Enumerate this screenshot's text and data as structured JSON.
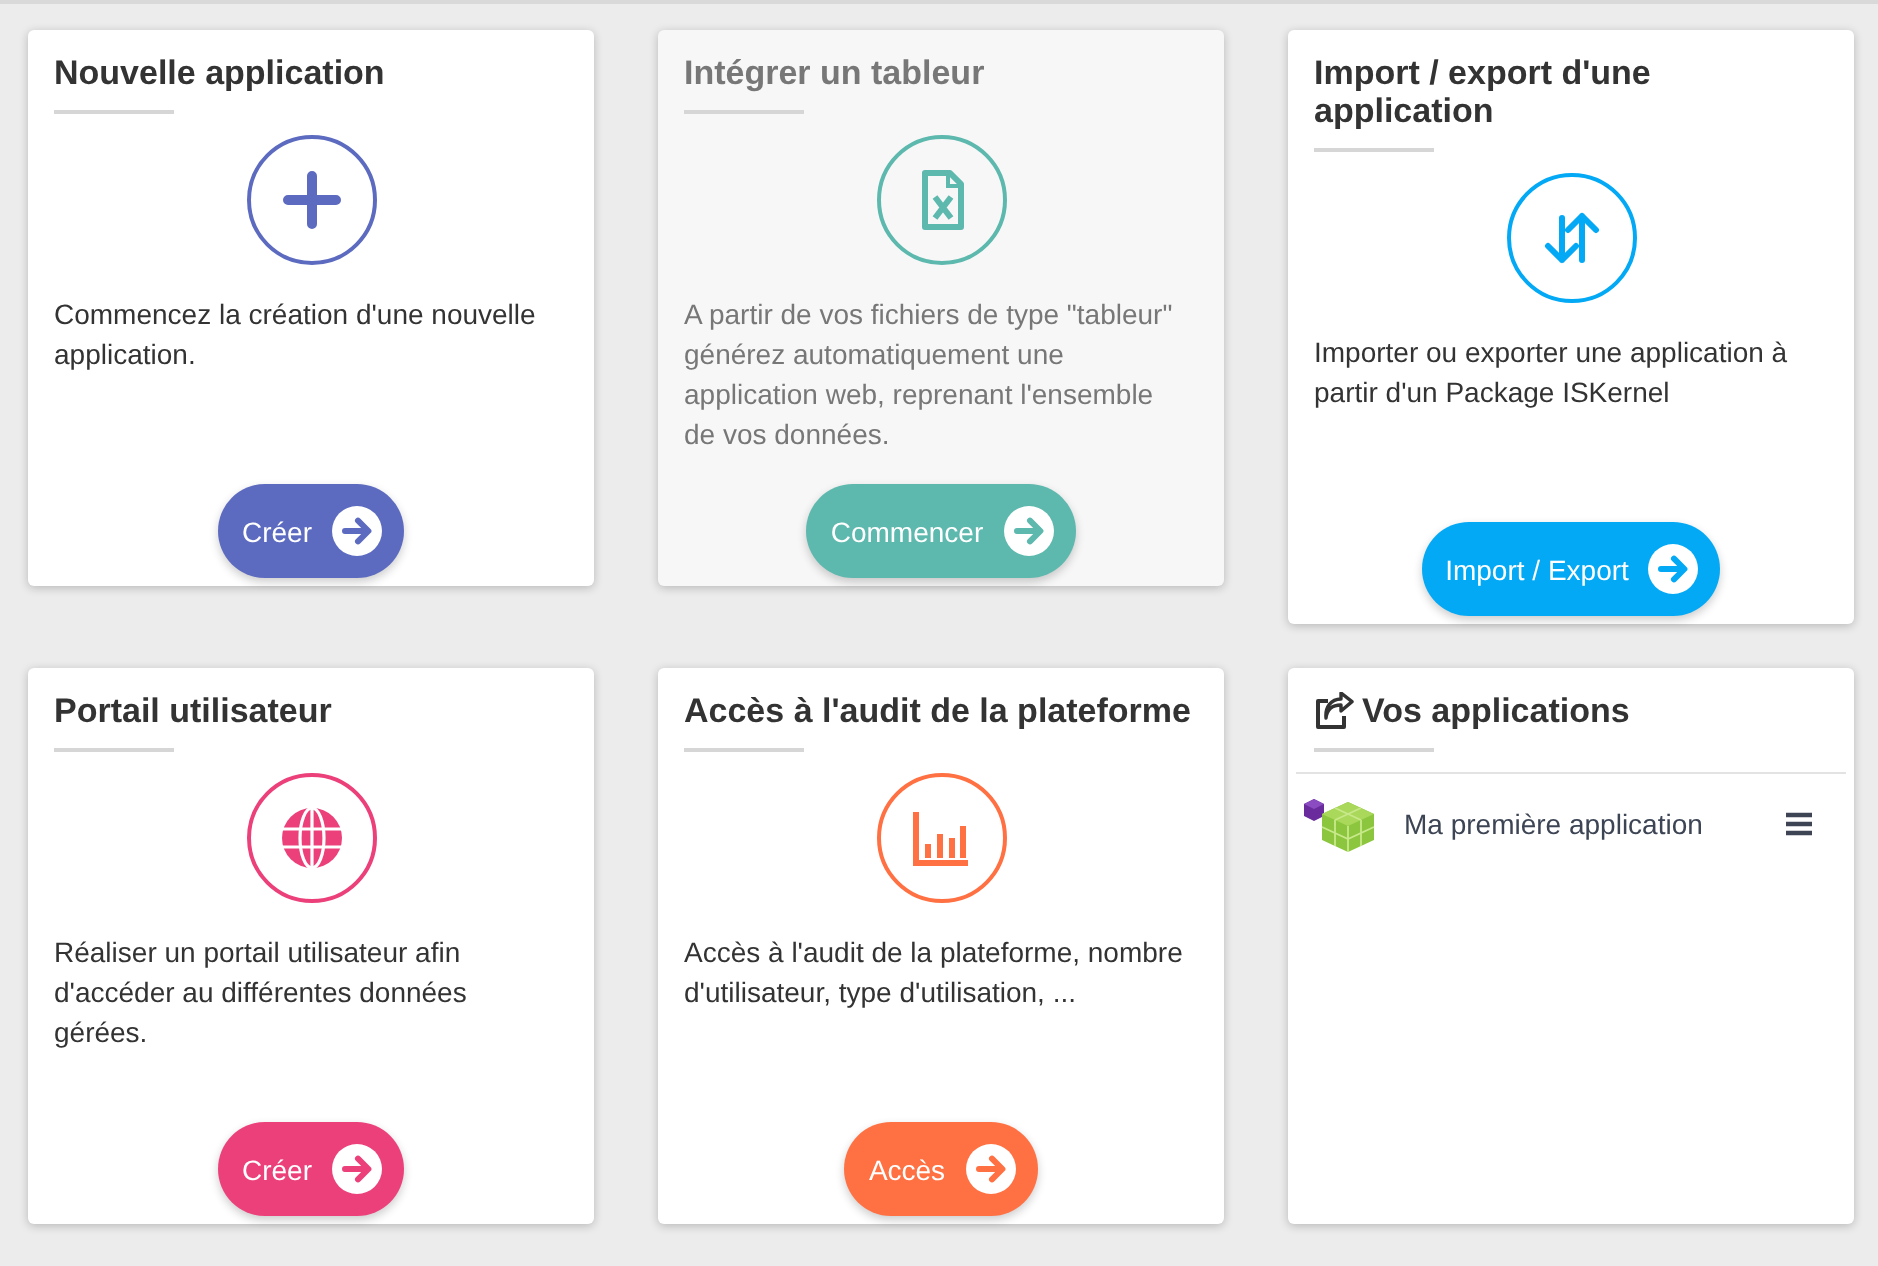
{
  "cards": [
    {
      "title": "Nouvelle application",
      "description": "Commencez la création d'une nouvelle application.",
      "button": "Créer",
      "color": "#5c6bc0",
      "disabled": false
    },
    {
      "title": "Intégrer un tableur",
      "description": "A partir de vos fichiers de type \"tableur\" générez automatiquement une application web, reprenant l'ensemble de vos données.",
      "button": "Commencer",
      "color": "#5db8ae",
      "disabled": true
    },
    {
      "title": "Import / export d'une application",
      "description": "Importer ou exporter une application à partir d'un Package ISKernel",
      "button": "Import / Export",
      "color": "#03a9f4",
      "disabled": false
    },
    {
      "title": "Portail utilisateur",
      "description": "Réaliser un portail utilisateur afin d'accéder au différentes données gérées.",
      "button": "Créer",
      "color": "#ec407a",
      "disabled": false
    },
    {
      "title": "Accès à l'audit de la plateforme",
      "description": "Accès à l'audit de la plateforme, nombre d'utilisateur, type d'utilisation, ...",
      "button": "Accès",
      "color": "#ff7043",
      "disabled": false
    }
  ],
  "apps_panel": {
    "title": "Vos applications",
    "apps": [
      {
        "name": "Ma première application"
      }
    ]
  }
}
